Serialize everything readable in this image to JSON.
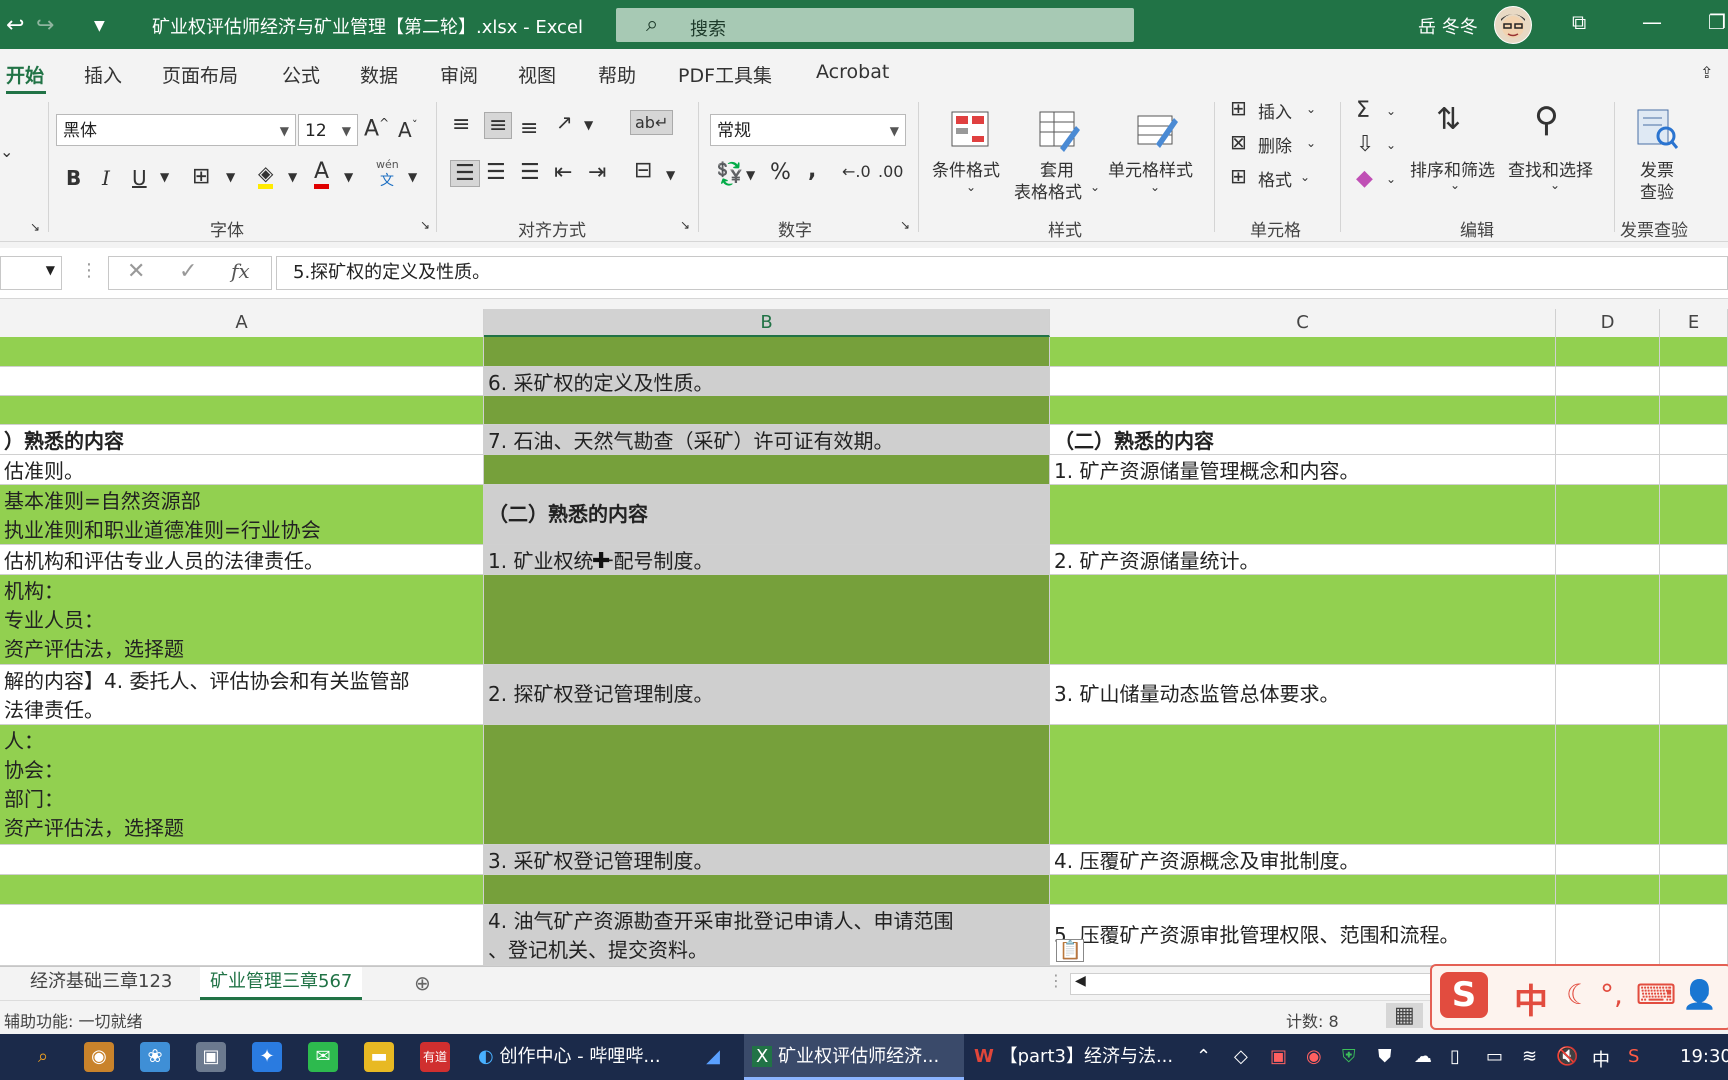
{
  "titlebar": {
    "title": "矿业权评估师经济与矿业管理【第二轮】.xlsx  -  Excel",
    "search_placeholder": "搜索",
    "user": "岳 冬冬"
  },
  "menu": {
    "tabs": [
      "开始",
      "插入",
      "页面布局",
      "公式",
      "数据",
      "审阅",
      "视图",
      "帮助",
      "PDF工具集",
      "Acrobat"
    ]
  },
  "ribbon": {
    "font_name": "黑体",
    "font_size": "12",
    "number_format": "常规",
    "groups": {
      "font": "字体",
      "alignment": "对齐方式",
      "number": "数字",
      "styles": "样式",
      "cells": "单元格",
      "editing": "编辑",
      "invoice": "发票查验"
    },
    "styles_buttons": {
      "conditional": "条件格式",
      "table_1": "套用",
      "table_2": "表格格式",
      "cell_style": "单元格样式"
    },
    "cells_buttons": {
      "insert": "插入",
      "delete": "删除",
      "format": "格式"
    },
    "editing_buttons": {
      "sort": "排序和筛选",
      "find": "查找和选择"
    },
    "invoice_buttons": {
      "line1": "发票",
      "line2": "查验"
    },
    "pinyin_label": "wén",
    "pinyin_char": "文"
  },
  "formula_bar": {
    "content": "5.探矿权的定义及性质。"
  },
  "columns": [
    "A",
    "B",
    "C",
    "D",
    "E"
  ],
  "cells": {
    "b_r2": "6. 采矿权的定义及性质。",
    "a_r4": "）熟悉的内容",
    "b_r4": "7. 石油、天然气勘查（采矿）许可证有效期。",
    "c_r4": "（二）熟悉的内容",
    "a_r5": "估准则。",
    "c_r5": "1. 矿产资源储量管理概念和内容。",
    "a_r6": "基本准则=自然资源部\n执业准则和职业道德准则=行业协会",
    "b_r6": "（二）熟悉的内容",
    "a_r7": "估机构和评估专业人员的法律责任。",
    "b_r7": "1. 矿业权统一配号制度。",
    "c_r7": "2. 矿产资源储量统计。",
    "a_r8": "机构：\n专业人员：\n资产评估法，选择题",
    "a_r9": "解的内容】4. 委托人、评估协会和有关监管部\n法律责任。",
    "b_r9": "2. 探矿权登记管理制度。",
    "c_r9": "3. 矿山储量动态监管总体要求。",
    "a_r10": "人：\n协会：\n部门：\n资产评估法，选择题",
    "b_r11": "3. 采矿权登记管理制度。",
    "c_r11": "4. 压覆矿产资源概念及审批制度。",
    "b_r13": "4. 油气矿产资源勘查开采审批登记申请人、申请范围\n、登记机关、提交资料。",
    "c_r13": "5. 压覆矿产资源审批管理权限、范围和流程。"
  },
  "sheets": [
    "经济基础三章123",
    "矿业管理三章567"
  ],
  "status": {
    "accessibility": "辅助功能: 一切就绪",
    "count": "计数: 8"
  },
  "ime": {
    "logo": "S",
    "mode": "中"
  },
  "taskbar": {
    "apps": [
      "创作中心 - 哔哩哔...",
      "矿业权评估师经济...",
      "【part3】经济与法..."
    ],
    "ime_indicator": "中",
    "time": "19:30"
  }
}
